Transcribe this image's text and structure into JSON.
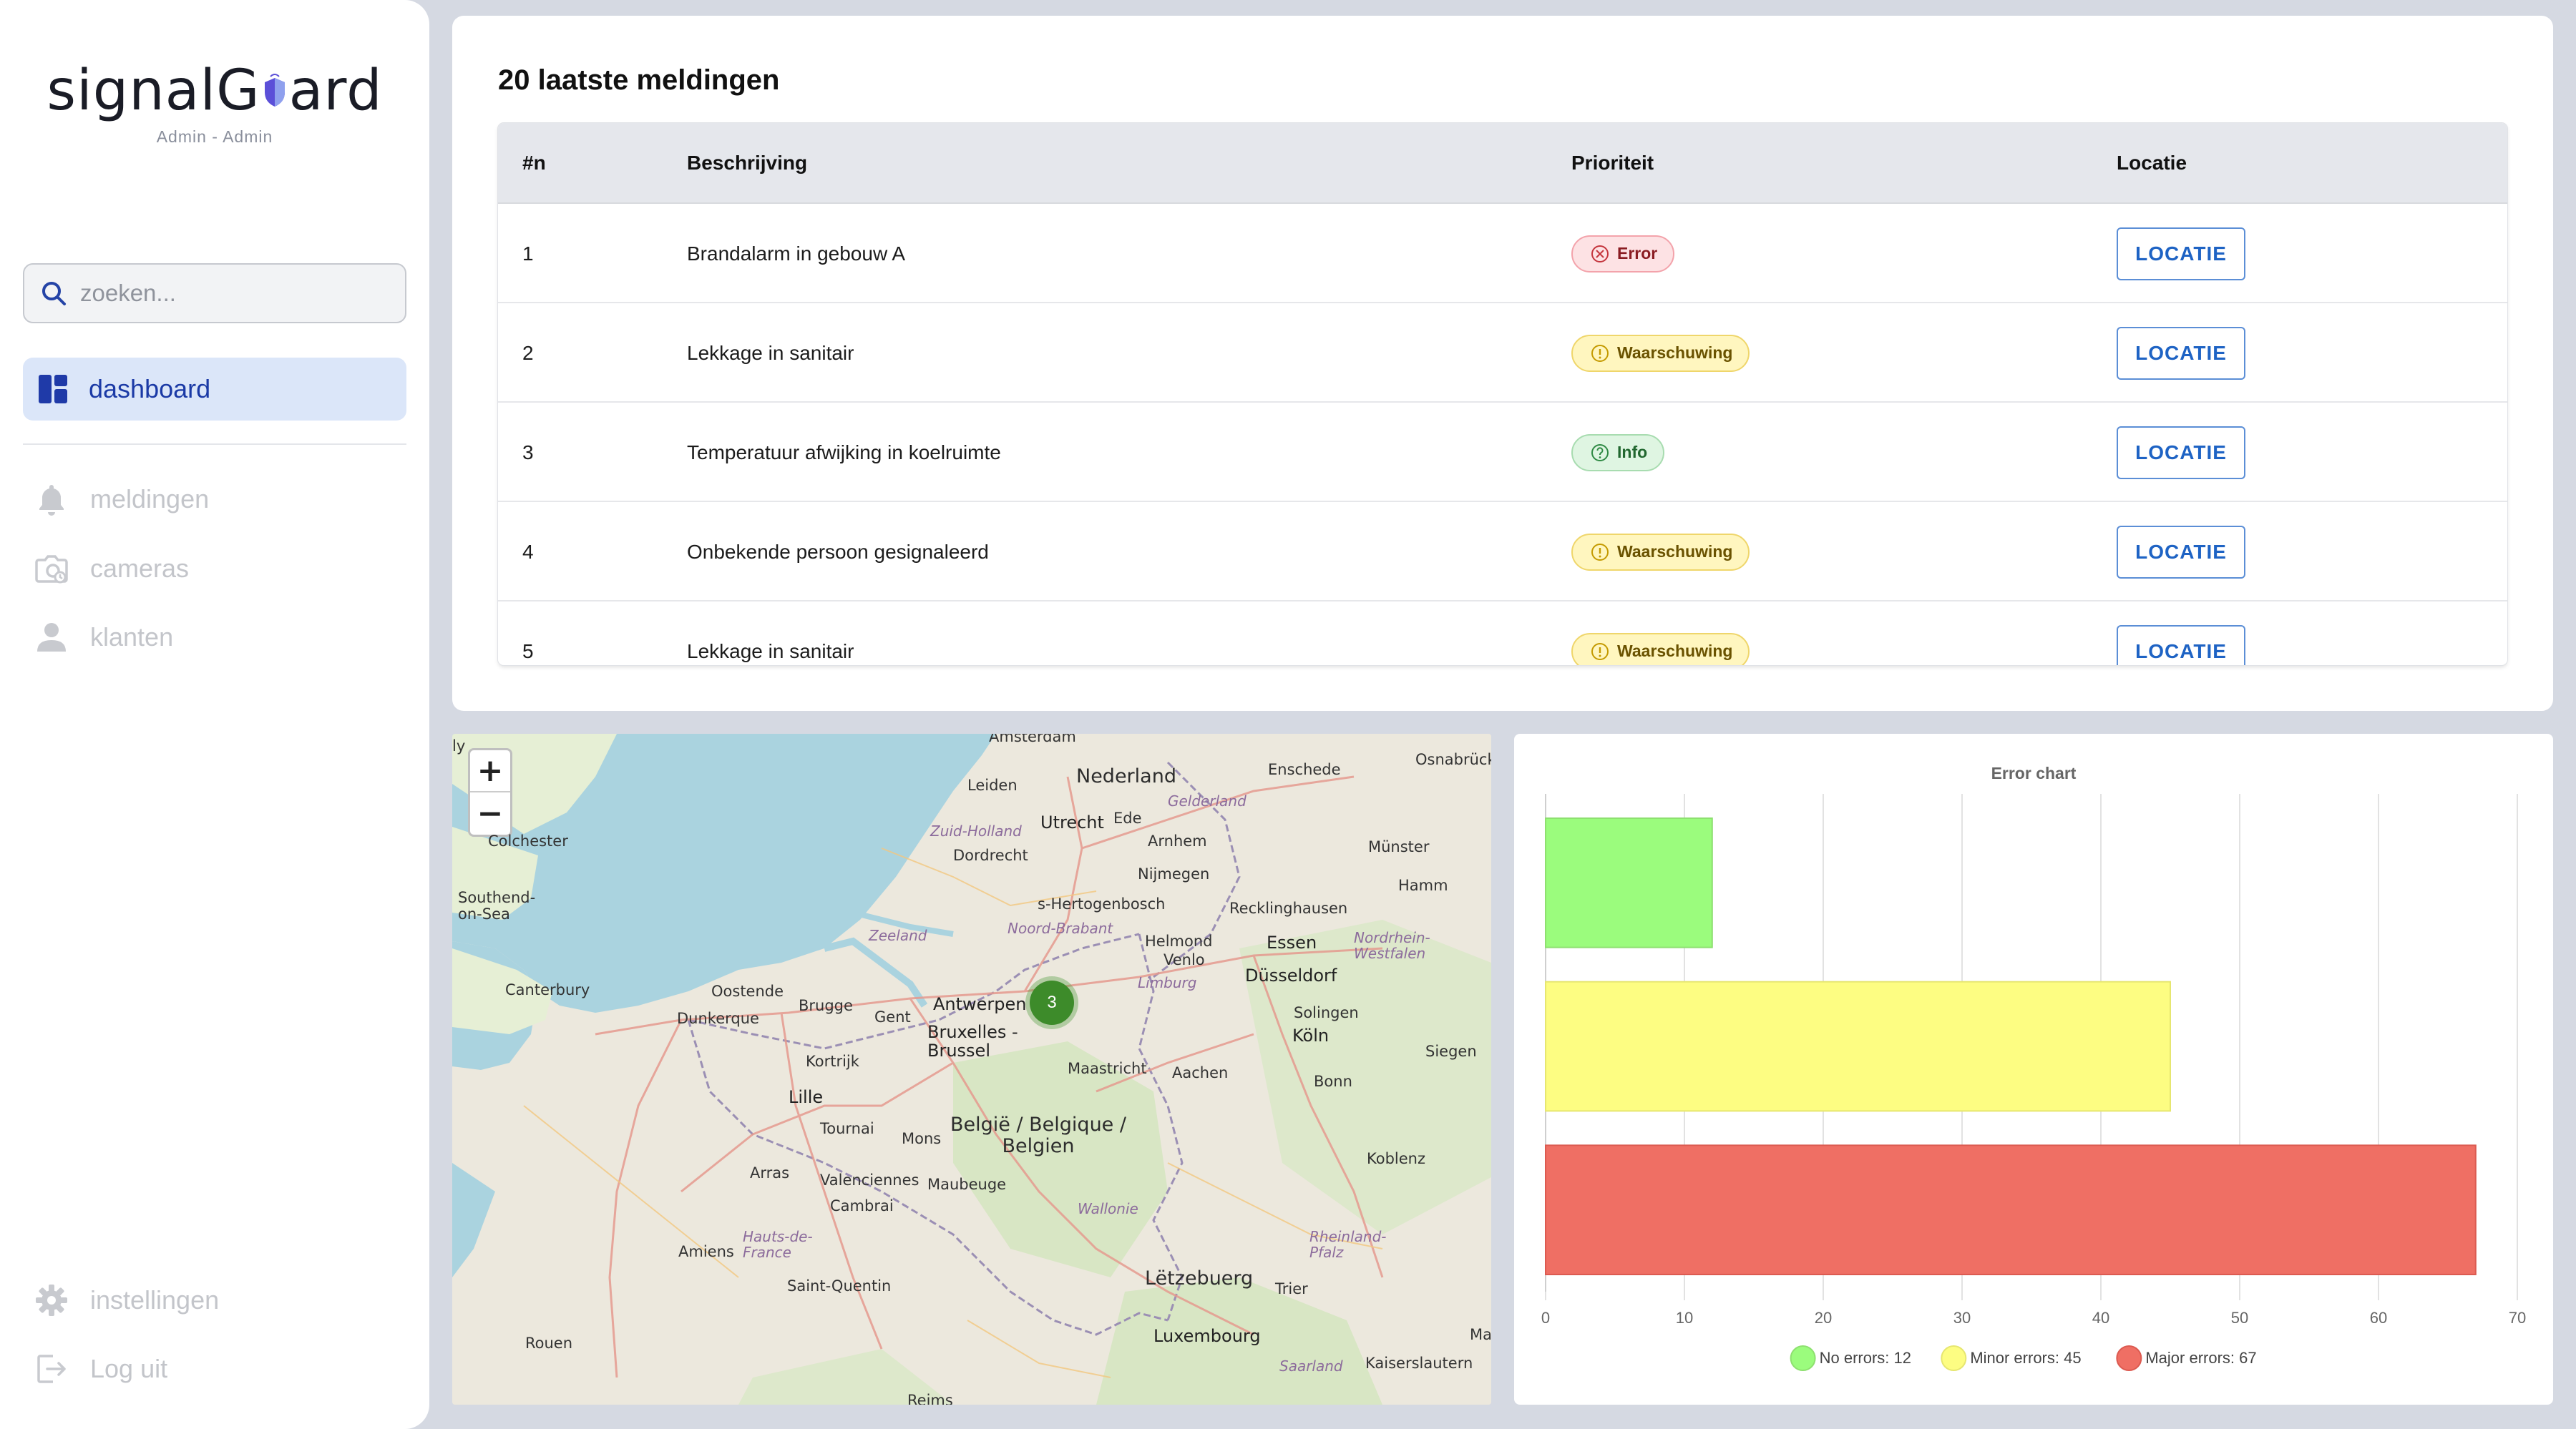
{
  "brand": {
    "logo_text_1": "signalG",
    "logo_text_2": "ard",
    "user_line": "Admin - Admin"
  },
  "sidebar": {
    "search_placeholder": "zoeken...",
    "active_item": {
      "label": "dashboard",
      "icon": "dashboard-icon"
    },
    "items": [
      {
        "label": "meldingen",
        "icon": "bell-icon"
      },
      {
        "label": "cameras",
        "icon": "camera-icon"
      },
      {
        "label": "klanten",
        "icon": "person-icon"
      }
    ],
    "bottom_items": [
      {
        "label": "instellingen",
        "icon": "gear-icon"
      },
      {
        "label": "Log uit",
        "icon": "logout-icon"
      }
    ]
  },
  "notifications": {
    "title": "20 laatste meldingen",
    "columns": [
      "#n",
      "Beschrijving",
      "Prioriteit",
      "Locatie"
    ],
    "rows": [
      {
        "n": "1",
        "description": "Brandalarm in gebouw A",
        "priority": "Error",
        "level": "error",
        "action": "LOCATIE"
      },
      {
        "n": "2",
        "description": "Lekkage in sanitair",
        "priority": "Waarschuwing",
        "level": "warn",
        "action": "LOCATIE"
      },
      {
        "n": "3",
        "description": "Temperatuur afwijking in koelruimte",
        "priority": "Info",
        "level": "info",
        "action": "LOCATIE"
      },
      {
        "n": "4",
        "description": "Onbekende persoon gesignaleerd",
        "priority": "Waarschuwing",
        "level": "warn",
        "action": "LOCATIE"
      },
      {
        "n": "5",
        "description": "Lekkage in sanitair",
        "priority": "Waarschuwing",
        "level": "warn",
        "action": "LOCATIE"
      }
    ]
  },
  "map": {
    "zoom_in": "+",
    "zoom_out": "−",
    "cluster_count": "3",
    "labels": {
      "amsterdam": "Amsterdam",
      "nederland": "Nederland",
      "leiden": "Leiden",
      "utrecht": "Utrecht",
      "ede": "Ede",
      "enschede": "Enschede",
      "osnabruck": "Osnabrück",
      "gelderland": "Gelderland",
      "zuid_holland": "Zuid-Holland",
      "arnhem": "Arnhem",
      "dordrecht": "Dordrecht",
      "nijmegen": "Nijmegen",
      "munster": "Münster",
      "colchester": "Colchester",
      "southend": "Southend-\non-Sea",
      "s_hertogenbosch": "s-Hertogenbosch",
      "recklinghausen": "Recklinghausen",
      "hamm": "Hamm",
      "zeeland": "Zeeland",
      "noord_brabant": "Noord-Brabant",
      "helmond": "Helmond",
      "essen": "Essen",
      "nordrhein": "Nordrhein-\nWestfalen",
      "venlo": "Venlo",
      "canterbury": "Canterbury",
      "oostende": "Oostende",
      "brugge": "Brugge",
      "antwerpen": "Antwerpen",
      "limburg": "Limburg",
      "dusseldorf": "Düsseldorf",
      "dunkerque": "Dunkerque",
      "gent": "Gent",
      "bruxelles": "Bruxelles -\nBrussel",
      "solingen": "Solingen",
      "koln": "Köln",
      "siegen": "Siegen",
      "kortrijk": "Kortrijk",
      "maastricht": "Maastricht",
      "aachen": "Aachen",
      "bonn": "Bonn",
      "lille": "Lille",
      "tournai": "Tournai",
      "mons": "Mons",
      "belgie": "België / Belgique /\nBelgien",
      "koblenz": "Koblenz",
      "arras": "Arras",
      "valenciennes": "Valenciennes",
      "maubeuge": "Maubeuge",
      "cambrai": "Cambrai",
      "wallonie": "Wallonie",
      "rheinland": "Rheinland-\nPfalz",
      "hauts": "Hauts-de-\nFrance",
      "amiens": "Amiens",
      "letzebuerg": "Lëtzebuerg",
      "trier": "Trier",
      "saint_quentin": "Saint-Quentin",
      "luxembourg": "Luxembourg",
      "rouen": "Rouen",
      "saarland": "Saarland",
      "kaiserslautern": "Kaiserslautern",
      "reims": "Reims",
      "ma": "Ma",
      "ly": "ly"
    }
  },
  "chart_data": {
    "type": "bar",
    "orientation": "horizontal",
    "title": "Error chart",
    "categories": [
      "No errors",
      "Minor errors",
      "Major errors"
    ],
    "values": [
      12,
      45,
      67
    ],
    "colors": [
      "#9bfc7d",
      "#fdfd82",
      "#ef6f64"
    ],
    "border_colors": [
      "#8ee070",
      "#e6e670",
      "#dc5a50"
    ],
    "xlim": [
      0,
      70
    ],
    "xticks": [
      0,
      10,
      20,
      30,
      40,
      50,
      60,
      70
    ],
    "legend_labels": [
      "No errors: 12",
      "Minor errors: 45",
      "Major errors: 67"
    ],
    "legend_position": "bottom",
    "grid": true
  }
}
